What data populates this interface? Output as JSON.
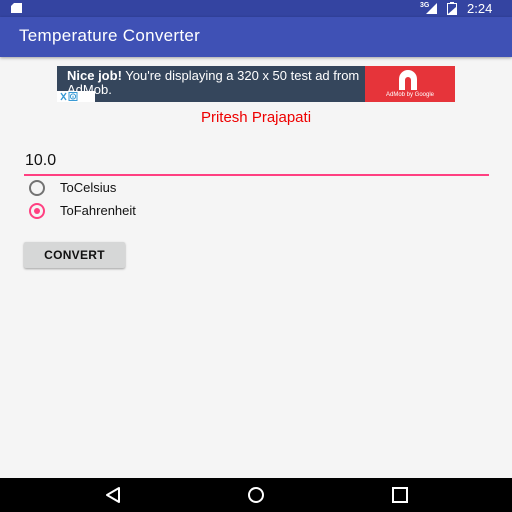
{
  "status_bar": {
    "network_label": "3G",
    "time": "2:24"
  },
  "app_bar": {
    "title": "Temperature Converter"
  },
  "ad_banner": {
    "text_bold": "Nice job!",
    "text_rest": " You're displaying a 320 x 50 test ad from AdMob.",
    "logo_caption": "AdMob by Google",
    "background_color": "#35465c",
    "logo_color": "#e6343a"
  },
  "author": {
    "name": "Pritesh Prajapati",
    "color": "#ee0000"
  },
  "temperature_input": {
    "value": "10.0"
  },
  "conversion_options": [
    {
      "label": "ToCelsius",
      "checked": false
    },
    {
      "label": "ToFahrenheit",
      "checked": true
    }
  ],
  "convert_button": {
    "label": "CONVERT"
  },
  "colors": {
    "primary": "#3f51b5",
    "primary_dark": "#3444a1",
    "accent": "#ff4081"
  },
  "icons": {
    "sd_card": "sd-card-icon",
    "signal": "signal-icon",
    "battery": "battery-icon",
    "back": "back-icon",
    "home": "home-icon",
    "recents": "recents-icon",
    "ad_logo": "admob-logo-icon",
    "adchoices": "adchoices-icon"
  }
}
